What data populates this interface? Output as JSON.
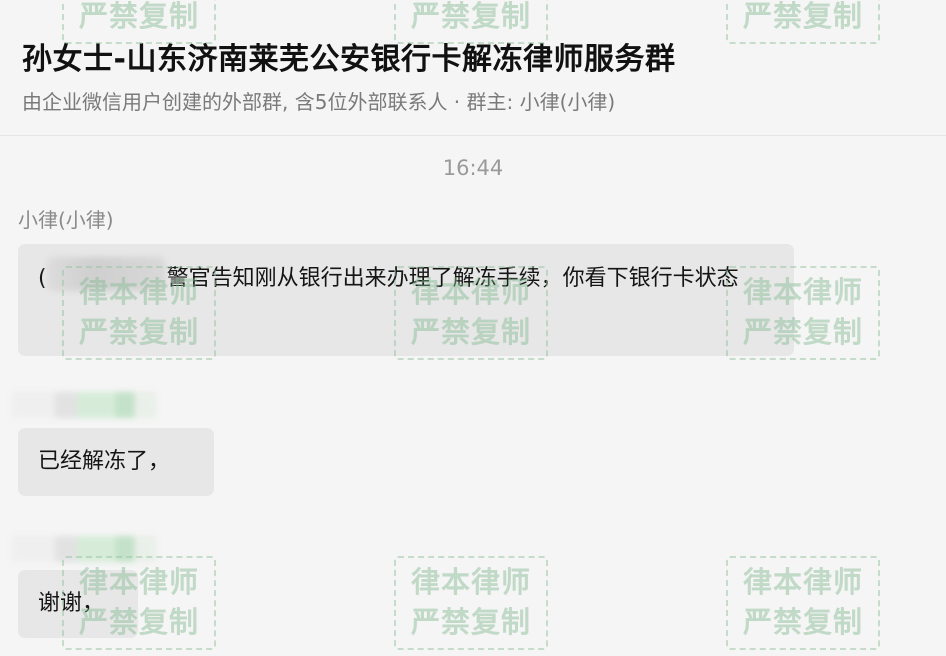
{
  "header": {
    "title": "孙女士-山东济南莱芜公安银行卡解冻律师服务群",
    "subtitle": "由企业微信用户创建的外部群, 含5位外部联系人 · 群主: 小律(小律)"
  },
  "chat": {
    "timestamp": "16:44",
    "sender_name": "小律(小律)",
    "messages": [
      {
        "prefix": "(",
        "text": "警官告知刚从银行出来办理了解冻手续，你看下银行卡状态"
      },
      {
        "text": "已经解冻了，"
      },
      {
        "text": "谢谢，"
      }
    ]
  },
  "watermark": {
    "line1": "律本律师",
    "line2": "严禁复制"
  }
}
